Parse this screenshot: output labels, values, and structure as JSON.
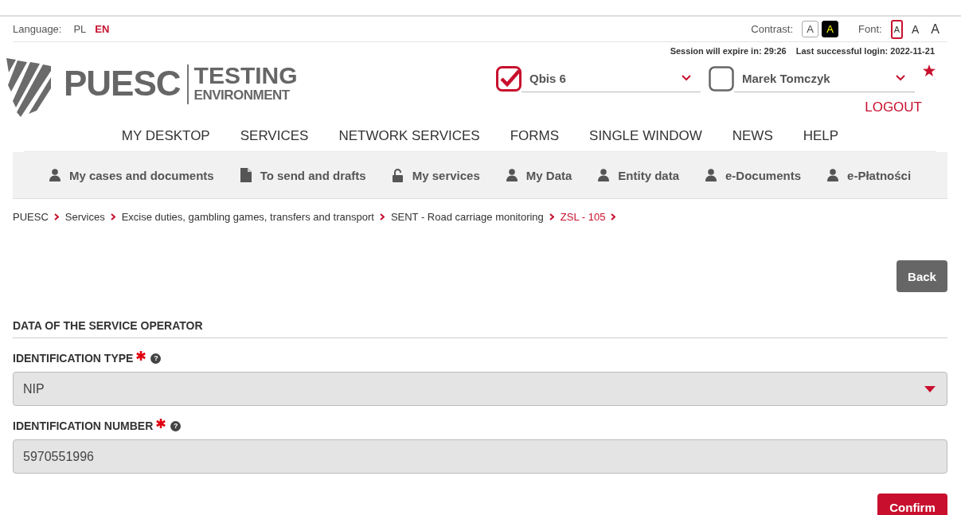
{
  "language": {
    "label": "Language:",
    "options": [
      {
        "label": "PL",
        "selected": false
      },
      {
        "label": "EN",
        "selected": true
      }
    ]
  },
  "contrast": {
    "label": "Contrast:",
    "options": [
      {
        "label": "A",
        "kind": "normal"
      },
      {
        "label": "A",
        "kind": "high"
      }
    ]
  },
  "font": {
    "label": "Font:",
    "options": [
      {
        "label": "A",
        "kind": "small",
        "selected": true
      },
      {
        "label": "A",
        "kind": "medium",
        "selected": false
      },
      {
        "label": "A",
        "kind": "large",
        "selected": false
      }
    ]
  },
  "session": {
    "expire": "Session will expire in: 29:26",
    "last_login": "Last successful login: 2022-11-21"
  },
  "logo": {
    "brand": "PUESC",
    "line1": "TESTING",
    "line2": "ENVIRONMENT"
  },
  "context": [
    {
      "label": "Qbis 6",
      "checked": true
    },
    {
      "label": "Marek Tomczyk",
      "checked": false
    }
  ],
  "logout": "LOGOUT",
  "main_nav": [
    "MY DESKTOP",
    "SERVICES",
    "NETWORK SERVICES",
    "FORMS",
    "SINGLE WINDOW",
    "NEWS",
    "HELP"
  ],
  "sub_nav": [
    {
      "label": "My cases and documents",
      "kind": "person"
    },
    {
      "label": "To send and drafts",
      "kind": "document"
    },
    {
      "label": "My services",
      "kind": "lock"
    },
    {
      "label": "My Data",
      "kind": "person"
    },
    {
      "label": "Entity data",
      "kind": "person"
    },
    {
      "label": "e-Documents",
      "kind": "person"
    },
    {
      "label": "e-Płatności",
      "kind": "person"
    }
  ],
  "breadcrumb": [
    {
      "label": "PUESC",
      "current": false
    },
    {
      "label": "Services",
      "current": false
    },
    {
      "label": "Excise duties, gambling games, transfers and transport",
      "current": false
    },
    {
      "label": "SENT - Road carriage monitoring",
      "current": false
    },
    {
      "label": "ZSL - 105",
      "current": true
    }
  ],
  "back": "Back",
  "section": {
    "title": "DATA OF THE SERVICE OPERATOR",
    "fields": [
      {
        "label": "IDENTIFICATION TYPE",
        "kind": "select",
        "value": "NIP",
        "required": true,
        "help": "?"
      },
      {
        "label": "IDENTIFICATION NUMBER",
        "kind": "input",
        "value": "5970551996",
        "required": true,
        "help": "?"
      }
    ]
  },
  "confirm": "Confirm"
}
